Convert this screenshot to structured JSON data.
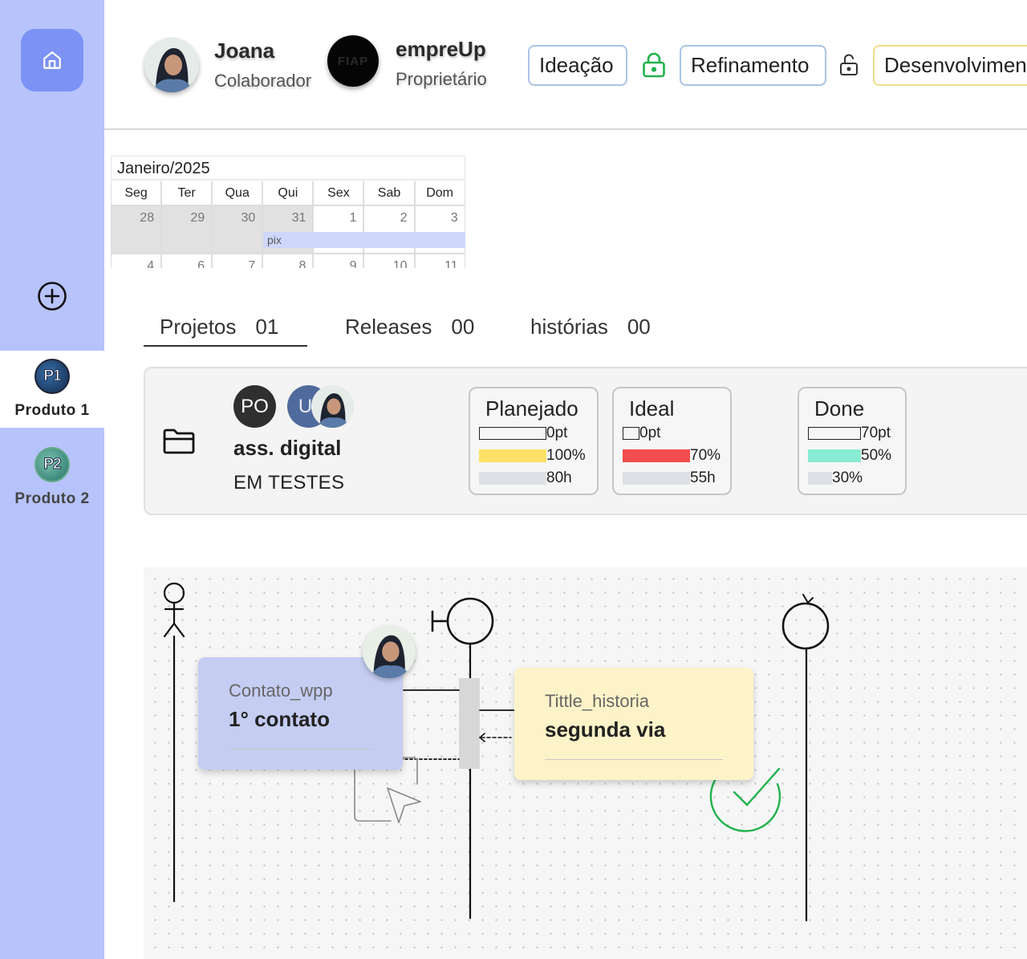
{
  "sidebar": {
    "products": [
      {
        "badge": "P1",
        "label": "Produto 1",
        "active": true
      },
      {
        "badge": "P2",
        "label": "Produto 2",
        "active": false
      }
    ]
  },
  "header": {
    "user": {
      "name": "Joana",
      "role": "Colaborador"
    },
    "org": {
      "name": "empreUp",
      "role": "Proprietário",
      "logo_text": "FIAP"
    },
    "phases": [
      {
        "label": "Ideação",
        "lock": "locked",
        "lock_color": "#22b14c"
      },
      {
        "label": "Refinamento",
        "lock": "unlocked",
        "lock_color": "#333333"
      },
      {
        "label": "Desenvolvimento"
      }
    ]
  },
  "calendar": {
    "month": "Janeiro/2025",
    "weekdays": [
      "Seg",
      "Ter",
      "Qua",
      "Qui",
      "Sex",
      "Sab",
      "Dom"
    ],
    "week1": [
      "28",
      "29",
      "30",
      "31",
      "1",
      "2",
      "3"
    ],
    "week2": [
      "4",
      "6",
      "7",
      "8",
      "9",
      "10",
      "11"
    ],
    "event": "pix"
  },
  "tabs": [
    {
      "label": "Projetos",
      "count": "01",
      "active": true
    },
    {
      "label": "Releases",
      "count": "00",
      "active": false
    },
    {
      "label": "histórias",
      "count": "00",
      "active": false
    }
  ],
  "project": {
    "name": "ass. digital",
    "status": "EM TESTES",
    "members": [
      "PO",
      "U"
    ],
    "metrics": [
      {
        "title": "Planejado",
        "rows": [
          {
            "text": "0pt",
            "fill": 1.0,
            "style": "outline"
          },
          {
            "text": "100%",
            "fill": 1.0,
            "style": "yellow"
          },
          {
            "text": "80h",
            "fill": 1.0,
            "style": "gray"
          }
        ]
      },
      {
        "title": "Ideal",
        "rows": [
          {
            "text": "0pt",
            "fill": 0.25,
            "style": "outline"
          },
          {
            "text": "70%",
            "fill": 1.0,
            "style": "red"
          },
          {
            "text": "55h",
            "fill": 1.0,
            "style": "gray"
          }
        ]
      },
      {
        "title": "Done",
        "rows": [
          {
            "text": "70pt",
            "fill": 1.0,
            "style": "outline"
          },
          {
            "text": "50%",
            "fill": 1.0,
            "style": "mint"
          },
          {
            "text": "30%",
            "fill": 0.45,
            "style": "gray"
          }
        ]
      }
    ]
  },
  "diagram": {
    "cards": [
      {
        "subtitle": "Contato_wpp",
        "title": "1° contato"
      },
      {
        "subtitle": "Tittle_historia",
        "title": "segunda via"
      }
    ]
  },
  "colors": {
    "sidebar_bg": "#b7c3fb",
    "home_button": "#7d92f5",
    "event_bg": "#cfd8fb",
    "card_blue": "#c5cdf3",
    "card_yellow": "#fdf3c8",
    "bar_yellow": "#fde166",
    "bar_red": "#f14d4d",
    "bar_mint": "#87ecd1",
    "bar_gray": "#dde0e4",
    "check_green": "#22b14c"
  }
}
